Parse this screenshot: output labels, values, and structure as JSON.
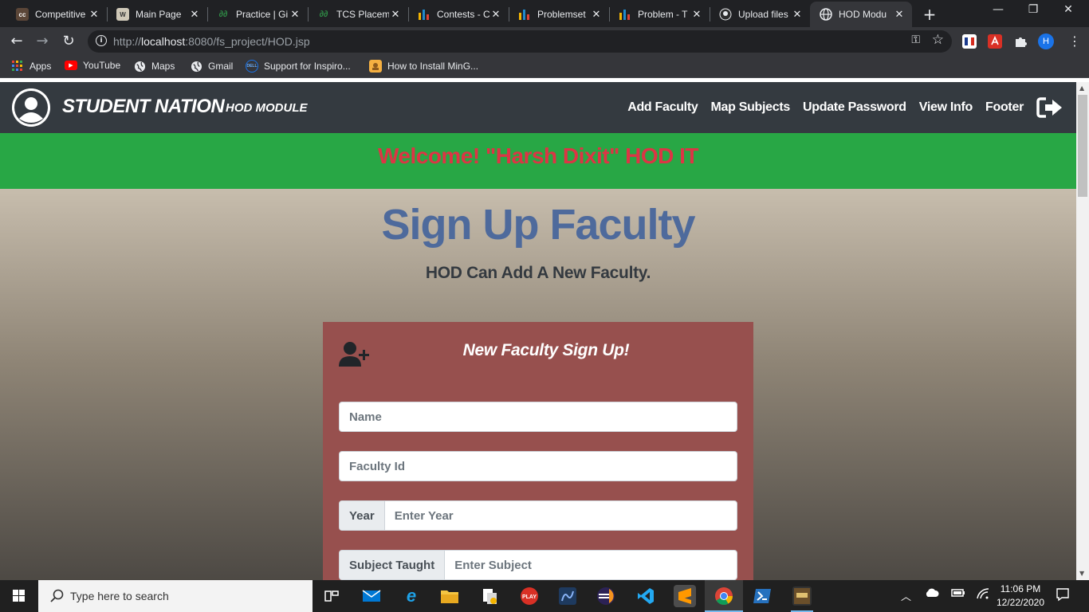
{
  "browser": {
    "tabs": [
      {
        "title": "Competitive",
        "icon": "codechef-icon",
        "color": "#5b4638"
      },
      {
        "title": "Main Page",
        "icon": "wiki-icon",
        "color": "#cfc8b8"
      },
      {
        "title": "Practice | Gi",
        "icon": "gfg-icon",
        "color": "#2f8d46"
      },
      {
        "title": "TCS Placem",
        "icon": "gfg-icon",
        "color": "#2f8d46"
      },
      {
        "title": "Contests - C",
        "icon": "hackerearth-icon",
        "color": "#2e6ee6"
      },
      {
        "title": "Problemset",
        "icon": "codeforces-icon",
        "color": "#1f8acb"
      },
      {
        "title": "Problem - T",
        "icon": "codeforces-icon",
        "color": "#1f8acb"
      },
      {
        "title": "Upload files",
        "icon": "github-icon",
        "color": "#e8eaed"
      },
      {
        "title": "HOD Modu",
        "icon": "chrome-globe-icon",
        "color": "#e8eaed",
        "active": true
      }
    ],
    "url_prefix": "http://",
    "url_host": "localhost",
    "url_rest": ":8080/fs_project/HOD.jsp",
    "bookmarks": [
      {
        "label": "Apps",
        "icon": "apps-grid-icon"
      },
      {
        "label": "YouTube",
        "icon": "youtube-icon"
      },
      {
        "label": "Maps",
        "icon": "globe-icon"
      },
      {
        "label": "Gmail",
        "icon": "globe-icon"
      },
      {
        "label": "Support for Inspiro...",
        "icon": "dell-icon"
      },
      {
        "label": "How to Install MinG...",
        "icon": "bookmark-image-icon"
      }
    ],
    "profile_initial": "H"
  },
  "site": {
    "brand": "STUDENT NATION",
    "module": "HOD MODULE",
    "nav": [
      "Add Faculty",
      "Map Subjects",
      "Update Password",
      "View Info",
      "Footer"
    ],
    "welcome": "Welcome! \"Harsh Dixit\" HOD IT",
    "title": "Sign Up Faculty",
    "subtitle": "HOD Can Add A New Faculty.",
    "colors": {
      "navbar": "#343a40",
      "welcome_bg": "#28a745",
      "welcome_text": "#dc3545",
      "title": "#4e6a9c",
      "card": "#97504e"
    }
  },
  "form": {
    "heading": "New Faculty Sign Up!",
    "name_placeholder": "Name",
    "faculty_id_placeholder": "Faculty Id",
    "year_label": "Year",
    "year_placeholder": "Enter Year",
    "subject_label": "Subject Taught",
    "subject_placeholder": "Enter Subject"
  },
  "taskbar": {
    "search_placeholder": "Type here to search",
    "time": "11:06 PM",
    "date": "12/22/2020"
  }
}
